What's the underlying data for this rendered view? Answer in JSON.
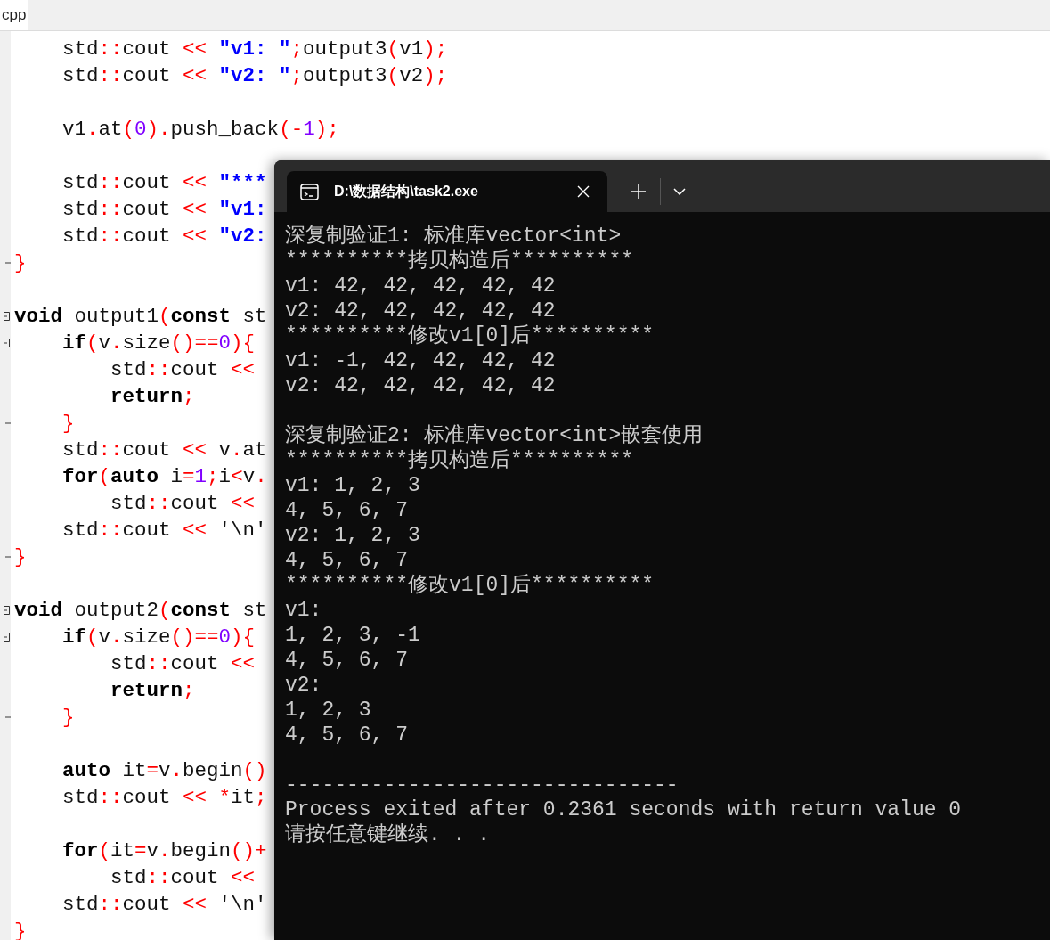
{
  "editor": {
    "tab": {
      "label": "cpp",
      "selected": true
    },
    "lines": [
      {
        "kind": "code",
        "tokens": [
          {
            "text": "    std",
            "kind": "plain"
          },
          {
            "text": "::",
            "kind": "op"
          },
          {
            "text": "cout ",
            "kind": "plain"
          },
          {
            "text": "<< ",
            "kind": "op"
          },
          {
            "text": "\"v1: \"",
            "kind": "string"
          },
          {
            "text": ";",
            "kind": "op"
          },
          {
            "text": "output3",
            "kind": "plain"
          },
          {
            "text": "(",
            "kind": "op"
          },
          {
            "text": "v1",
            "kind": "plain"
          },
          {
            "text": ");",
            "kind": "op"
          }
        ]
      },
      {
        "kind": "code",
        "tokens": [
          {
            "text": "    std",
            "kind": "plain"
          },
          {
            "text": "::",
            "kind": "op"
          },
          {
            "text": "cout ",
            "kind": "plain"
          },
          {
            "text": "<< ",
            "kind": "op"
          },
          {
            "text": "\"v2: \"",
            "kind": "string"
          },
          {
            "text": ";",
            "kind": "op"
          },
          {
            "text": "output3",
            "kind": "plain"
          },
          {
            "text": "(",
            "kind": "op"
          },
          {
            "text": "v2",
            "kind": "plain"
          },
          {
            "text": ");",
            "kind": "op"
          }
        ]
      },
      {
        "kind": "blank"
      },
      {
        "kind": "code",
        "tokens": [
          {
            "text": "    v1",
            "kind": "plain"
          },
          {
            "text": ".",
            "kind": "op"
          },
          {
            "text": "at",
            "kind": "plain"
          },
          {
            "text": "(",
            "kind": "op"
          },
          {
            "text": "0",
            "kind": "number"
          },
          {
            "text": ").",
            "kind": "op"
          },
          {
            "text": "push_back",
            "kind": "plain"
          },
          {
            "text": "(-",
            "kind": "op"
          },
          {
            "text": "1",
            "kind": "number"
          },
          {
            "text": ");",
            "kind": "op"
          }
        ]
      },
      {
        "kind": "blank"
      },
      {
        "kind": "code",
        "tokens": [
          {
            "text": "    std",
            "kind": "plain"
          },
          {
            "text": "::",
            "kind": "op"
          },
          {
            "text": "cout ",
            "kind": "plain"
          },
          {
            "text": "<< ",
            "kind": "op"
          },
          {
            "text": "\"***",
            "kind": "string"
          }
        ]
      },
      {
        "kind": "code",
        "tokens": [
          {
            "text": "    std",
            "kind": "plain"
          },
          {
            "text": "::",
            "kind": "op"
          },
          {
            "text": "cout ",
            "kind": "plain"
          },
          {
            "text": "<< ",
            "kind": "op"
          },
          {
            "text": "\"v1:",
            "kind": "string"
          }
        ]
      },
      {
        "kind": "code",
        "tokens": [
          {
            "text": "    std",
            "kind": "plain"
          },
          {
            "text": "::",
            "kind": "op"
          },
          {
            "text": "cout ",
            "kind": "plain"
          },
          {
            "text": "<< ",
            "kind": "op"
          },
          {
            "text": "\"v2:",
            "kind": "string"
          }
        ]
      },
      {
        "kind": "fold_end",
        "tokens": [
          {
            "text": "}",
            "kind": "op"
          }
        ]
      },
      {
        "kind": "blank"
      },
      {
        "kind": "fold_start",
        "tokens": [
          {
            "text": "void",
            "kind": "keyword"
          },
          {
            "text": " output1",
            "kind": "plain"
          },
          {
            "text": "(",
            "kind": "op"
          },
          {
            "text": "const",
            "kind": "keyword"
          },
          {
            "text": " st",
            "kind": "plain"
          }
        ]
      },
      {
        "kind": "fold_start",
        "tokens": [
          {
            "text": "    if",
            "kind": "keyword"
          },
          {
            "text": "(",
            "kind": "op"
          },
          {
            "text": "v",
            "kind": "plain"
          },
          {
            "text": ".",
            "kind": "op"
          },
          {
            "text": "size",
            "kind": "plain"
          },
          {
            "text": "()==",
            "kind": "op"
          },
          {
            "text": "0",
            "kind": "number"
          },
          {
            "text": "){",
            "kind": "op"
          }
        ]
      },
      {
        "kind": "code",
        "tokens": [
          {
            "text": "        std",
            "kind": "plain"
          },
          {
            "text": "::",
            "kind": "op"
          },
          {
            "text": "cout ",
            "kind": "plain"
          },
          {
            "text": "<<",
            "kind": "op"
          }
        ]
      },
      {
        "kind": "code",
        "tokens": [
          {
            "text": "        return",
            "kind": "keyword"
          },
          {
            "text": ";",
            "kind": "op"
          }
        ]
      },
      {
        "kind": "fold_end",
        "tokens": [
          {
            "text": "    }",
            "kind": "op"
          }
        ]
      },
      {
        "kind": "code",
        "tokens": [
          {
            "text": "    std",
            "kind": "plain"
          },
          {
            "text": "::",
            "kind": "op"
          },
          {
            "text": "cout ",
            "kind": "plain"
          },
          {
            "text": "<<",
            "kind": "op"
          },
          {
            "text": " v",
            "kind": "plain"
          },
          {
            "text": ".",
            "kind": "op"
          },
          {
            "text": "at",
            "kind": "plain"
          }
        ]
      },
      {
        "kind": "code",
        "tokens": [
          {
            "text": "    for",
            "kind": "keyword"
          },
          {
            "text": "(",
            "kind": "op"
          },
          {
            "text": "auto",
            "kind": "keyword"
          },
          {
            "text": " i",
            "kind": "plain"
          },
          {
            "text": "=",
            "kind": "op"
          },
          {
            "text": "1",
            "kind": "number"
          },
          {
            "text": ";",
            "kind": "op"
          },
          {
            "text": "i",
            "kind": "plain"
          },
          {
            "text": "<",
            "kind": "op"
          },
          {
            "text": "v",
            "kind": "plain"
          },
          {
            "text": ".",
            "kind": "op"
          }
        ]
      },
      {
        "kind": "code",
        "tokens": [
          {
            "text": "        std",
            "kind": "plain"
          },
          {
            "text": "::",
            "kind": "op"
          },
          {
            "text": "cout ",
            "kind": "plain"
          },
          {
            "text": "<<",
            "kind": "op"
          }
        ]
      },
      {
        "kind": "code",
        "tokens": [
          {
            "text": "    std",
            "kind": "plain"
          },
          {
            "text": "::",
            "kind": "op"
          },
          {
            "text": "cout ",
            "kind": "plain"
          },
          {
            "text": "<<",
            "kind": "op"
          },
          {
            "text": " '\\n'",
            "kind": "plain"
          }
        ]
      },
      {
        "kind": "fold_end",
        "tokens": [
          {
            "text": "}",
            "kind": "op"
          }
        ]
      },
      {
        "kind": "blank"
      },
      {
        "kind": "fold_start",
        "tokens": [
          {
            "text": "void",
            "kind": "keyword"
          },
          {
            "text": " output2",
            "kind": "plain"
          },
          {
            "text": "(",
            "kind": "op"
          },
          {
            "text": "const",
            "kind": "keyword"
          },
          {
            "text": " st",
            "kind": "plain"
          }
        ]
      },
      {
        "kind": "fold_start",
        "tokens": [
          {
            "text": "    if",
            "kind": "keyword"
          },
          {
            "text": "(",
            "kind": "op"
          },
          {
            "text": "v",
            "kind": "plain"
          },
          {
            "text": ".",
            "kind": "op"
          },
          {
            "text": "size",
            "kind": "plain"
          },
          {
            "text": "()==",
            "kind": "op"
          },
          {
            "text": "0",
            "kind": "number"
          },
          {
            "text": "){",
            "kind": "op"
          }
        ]
      },
      {
        "kind": "code",
        "tokens": [
          {
            "text": "        std",
            "kind": "plain"
          },
          {
            "text": "::",
            "kind": "op"
          },
          {
            "text": "cout ",
            "kind": "plain"
          },
          {
            "text": "<<",
            "kind": "op"
          }
        ]
      },
      {
        "kind": "code",
        "tokens": [
          {
            "text": "        return",
            "kind": "keyword"
          },
          {
            "text": ";",
            "kind": "op"
          }
        ]
      },
      {
        "kind": "fold_end",
        "tokens": [
          {
            "text": "    }",
            "kind": "op"
          }
        ]
      },
      {
        "kind": "blank"
      },
      {
        "kind": "code",
        "tokens": [
          {
            "text": "    auto",
            "kind": "keyword"
          },
          {
            "text": " it",
            "kind": "plain"
          },
          {
            "text": "=",
            "kind": "op"
          },
          {
            "text": "v",
            "kind": "plain"
          },
          {
            "text": ".",
            "kind": "op"
          },
          {
            "text": "begin",
            "kind": "plain"
          },
          {
            "text": "()",
            "kind": "op"
          }
        ]
      },
      {
        "kind": "code",
        "tokens": [
          {
            "text": "    std",
            "kind": "plain"
          },
          {
            "text": "::",
            "kind": "op"
          },
          {
            "text": "cout ",
            "kind": "plain"
          },
          {
            "text": "<< *",
            "kind": "op"
          },
          {
            "text": "it",
            "kind": "plain"
          },
          {
            "text": ";",
            "kind": "op"
          }
        ]
      },
      {
        "kind": "blank"
      },
      {
        "kind": "code",
        "tokens": [
          {
            "text": "    for",
            "kind": "keyword"
          },
          {
            "text": "(",
            "kind": "op"
          },
          {
            "text": "it",
            "kind": "plain"
          },
          {
            "text": "=",
            "kind": "op"
          },
          {
            "text": "v",
            "kind": "plain"
          },
          {
            "text": ".",
            "kind": "op"
          },
          {
            "text": "begin",
            "kind": "plain"
          },
          {
            "text": "()+",
            "kind": "op"
          }
        ]
      },
      {
        "kind": "code",
        "tokens": [
          {
            "text": "        std",
            "kind": "plain"
          },
          {
            "text": "::",
            "kind": "op"
          },
          {
            "text": "cout ",
            "kind": "plain"
          },
          {
            "text": "<<",
            "kind": "op"
          }
        ]
      },
      {
        "kind": "code",
        "tokens": [
          {
            "text": "    std",
            "kind": "plain"
          },
          {
            "text": "::",
            "kind": "op"
          },
          {
            "text": "cout ",
            "kind": "plain"
          },
          {
            "text": "<<",
            "kind": "op"
          },
          {
            "text": " '\\n'",
            "kind": "plain"
          }
        ]
      },
      {
        "kind": "code",
        "tokens": [
          {
            "text": "}",
            "kind": "op"
          }
        ]
      }
    ]
  },
  "terminal": {
    "tab": {
      "title": "D:\\数据结构\\task2.exe",
      "selected": true
    },
    "lines": [
      {
        "kind": "text",
        "text": "深复制验证1: 标准库vector<int>"
      },
      {
        "kind": "text",
        "text": "**********拷贝构造后**********"
      },
      {
        "kind": "text",
        "text": "v1: 42, 42, 42, 42, 42"
      },
      {
        "kind": "text",
        "text": "v2: 42, 42, 42, 42, 42"
      },
      {
        "kind": "text",
        "text": "**********修改v1[0]后**********"
      },
      {
        "kind": "text",
        "text": "v1: -1, 42, 42, 42, 42"
      },
      {
        "kind": "text",
        "text": "v2: 42, 42, 42, 42, 42"
      },
      {
        "kind": "blank"
      },
      {
        "kind": "text",
        "text": "深复制验证2: 标准库vector<int>嵌套使用"
      },
      {
        "kind": "text",
        "text": "**********拷贝构造后**********"
      },
      {
        "kind": "text",
        "text": "v1: 1, 2, 3"
      },
      {
        "kind": "text",
        "text": "4, 5, 6, 7"
      },
      {
        "kind": "text",
        "text": "v2: 1, 2, 3"
      },
      {
        "kind": "text",
        "text": "4, 5, 6, 7"
      },
      {
        "kind": "text",
        "text": "**********修改v1[0]后**********"
      },
      {
        "kind": "text",
        "text": "v1:"
      },
      {
        "kind": "text",
        "text": "1, 2, 3, -1"
      },
      {
        "kind": "text",
        "text": "4, 5, 6, 7"
      },
      {
        "kind": "text",
        "text": "v2:"
      },
      {
        "kind": "text",
        "text": "1, 2, 3"
      },
      {
        "kind": "text",
        "text": "4, 5, 6, 7"
      },
      {
        "kind": "blank"
      },
      {
        "kind": "text",
        "text": "--------------------------------"
      },
      {
        "kind": "text",
        "text": "Process exited after 0.2361 seconds with return value 0"
      },
      {
        "kind": "text",
        "text": "请按任意键继续. . ."
      }
    ]
  }
}
